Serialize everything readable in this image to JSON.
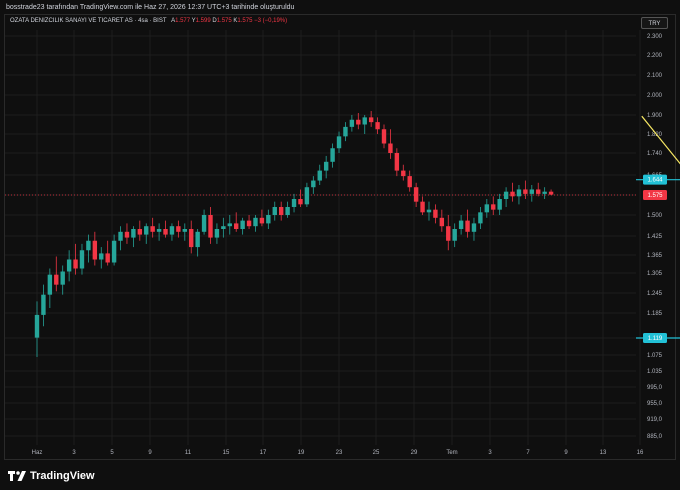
{
  "attribution": "bosstrade23 tarafından TradingView.com ile Haz 27, 2026 12:37 UTC+3 tarihinde oluşturuldu",
  "symbol_line": {
    "name": "OZATA DENIZCILIK SANAYI VE TICARET AS · 4sa · BIST",
    "o_label": "A",
    "o_value": "1.577",
    "h_label": "Y",
    "h_value": "1.599",
    "l_label": "D",
    "l_value": "1.575",
    "c_label": "K",
    "c_value": "1.575",
    "change": "−3 (−0,19%)"
  },
  "currency": "TRY",
  "brand": "TradingView",
  "colors": {
    "up": "#26a69a",
    "down": "#f23645",
    "pattern": "#f5e663",
    "level": "#22c1d6",
    "background": "#0f0f0f",
    "grid": "#1e1e1e"
  },
  "chart_data": {
    "type": "candlestick",
    "y_ticks": [
      "2.300",
      "2.200",
      "2.100",
      "2.000",
      "1.900",
      "1.820",
      "1.740",
      "1.665",
      "1.575",
      "1.500",
      "1.425",
      "1.365",
      "1.305",
      "1.245",
      "1.185",
      "1.119",
      "1.075",
      "1.035",
      "995,0",
      "955,0",
      "919,0",
      "885,0"
    ],
    "x_ticks": [
      "Haz",
      "3",
      "5",
      "9",
      "11",
      "15",
      "17",
      "19",
      "23",
      "25",
      "29",
      "Tem",
      "3",
      "7",
      "9",
      "13",
      "16"
    ],
    "last_price": {
      "value": 1.575,
      "label": "1.575"
    },
    "levels": [
      {
        "value": 1.644,
        "label": "1.644",
        "from_x": 23.0,
        "to_x": 40.0
      },
      {
        "value": 1.119,
        "label": "1.119",
        "from_x": 25.5,
        "to_x": 40.0
      }
    ],
    "projection": [
      {
        "x": 17.0,
        "y": 1.895
      },
      {
        "x": 20.0,
        "y": 1.36
      },
      {
        "x": 25.6,
        "y": 1.568
      },
      {
        "x": 29.0,
        "y": 1.119
      }
    ],
    "channel": {
      "upper": [
        {
          "x": 20.0,
          "y": 1.57
        },
        {
          "x": 26.5,
          "y": 1.785
        }
      ],
      "lower": [
        {
          "x": 20.0,
          "y": 1.36
        },
        {
          "x": 26.5,
          "y": 1.575
        }
      ],
      "mid": [
        {
          "x": 21.0,
          "y": 1.465
        },
        {
          "x": 26.5,
          "y": 1.66
        }
      ]
    },
    "candles": [
      {
        "x": 1.0,
        "o": 1.12,
        "h": 1.22,
        "l": 1.07,
        "c": 1.18
      },
      {
        "x": 1.17,
        "o": 1.18,
        "h": 1.27,
        "l": 1.15,
        "c": 1.24
      },
      {
        "x": 1.34,
        "o": 1.24,
        "h": 1.32,
        "l": 1.2,
        "c": 1.3
      },
      {
        "x": 1.51,
        "o": 1.3,
        "h": 1.36,
        "l": 1.25,
        "c": 1.27
      },
      {
        "x": 1.68,
        "o": 1.27,
        "h": 1.33,
        "l": 1.24,
        "c": 1.31
      },
      {
        "x": 1.85,
        "o": 1.31,
        "h": 1.38,
        "l": 1.28,
        "c": 1.35
      },
      {
        "x": 2.02,
        "o": 1.35,
        "h": 1.4,
        "l": 1.3,
        "c": 1.32
      },
      {
        "x": 2.19,
        "o": 1.32,
        "h": 1.4,
        "l": 1.3,
        "c": 1.38
      },
      {
        "x": 2.36,
        "o": 1.38,
        "h": 1.43,
        "l": 1.34,
        "c": 1.41
      },
      {
        "x": 2.53,
        "o": 1.41,
        "h": 1.44,
        "l": 1.33,
        "c": 1.35
      },
      {
        "x": 2.7,
        "o": 1.35,
        "h": 1.39,
        "l": 1.32,
        "c": 1.37
      },
      {
        "x": 2.87,
        "o": 1.37,
        "h": 1.41,
        "l": 1.33,
        "c": 1.34
      },
      {
        "x": 3.04,
        "o": 1.34,
        "h": 1.43,
        "l": 1.33,
        "c": 1.41
      },
      {
        "x": 3.21,
        "o": 1.41,
        "h": 1.46,
        "l": 1.38,
        "c": 1.44
      },
      {
        "x": 3.38,
        "o": 1.44,
        "h": 1.47,
        "l": 1.4,
        "c": 1.42
      },
      {
        "x": 3.55,
        "o": 1.42,
        "h": 1.46,
        "l": 1.39,
        "c": 1.45
      },
      {
        "x": 3.72,
        "o": 1.45,
        "h": 1.48,
        "l": 1.41,
        "c": 1.43
      },
      {
        "x": 3.89,
        "o": 1.43,
        "h": 1.47,
        "l": 1.4,
        "c": 1.46
      },
      {
        "x": 4.06,
        "o": 1.46,
        "h": 1.49,
        "l": 1.42,
        "c": 1.44
      },
      {
        "x": 4.23,
        "o": 1.44,
        "h": 1.47,
        "l": 1.41,
        "c": 1.45
      },
      {
        "x": 4.4,
        "o": 1.45,
        "h": 1.48,
        "l": 1.42,
        "c": 1.43
      },
      {
        "x": 4.57,
        "o": 1.43,
        "h": 1.47,
        "l": 1.41,
        "c": 1.46
      },
      {
        "x": 4.74,
        "o": 1.46,
        "h": 1.48,
        "l": 1.42,
        "c": 1.44
      },
      {
        "x": 4.91,
        "o": 1.44,
        "h": 1.47,
        "l": 1.41,
        "c": 1.45
      },
      {
        "x": 5.08,
        "o": 1.45,
        "h": 1.48,
        "l": 1.37,
        "c": 1.39
      },
      {
        "x": 5.25,
        "o": 1.39,
        "h": 1.45,
        "l": 1.36,
        "c": 1.44
      },
      {
        "x": 5.42,
        "o": 1.44,
        "h": 1.52,
        "l": 1.43,
        "c": 1.5
      },
      {
        "x": 5.59,
        "o": 1.5,
        "h": 1.53,
        "l": 1.4,
        "c": 1.42
      },
      {
        "x": 5.76,
        "o": 1.42,
        "h": 1.47,
        "l": 1.4,
        "c": 1.45
      },
      {
        "x": 5.93,
        "o": 1.45,
        "h": 1.49,
        "l": 1.42,
        "c": 1.46
      },
      {
        "x": 6.1,
        "o": 1.46,
        "h": 1.5,
        "l": 1.43,
        "c": 1.47
      },
      {
        "x": 6.27,
        "o": 1.47,
        "h": 1.51,
        "l": 1.44,
        "c": 1.45
      },
      {
        "x": 6.44,
        "o": 1.45,
        "h": 1.49,
        "l": 1.43,
        "c": 1.48
      },
      {
        "x": 6.61,
        "o": 1.48,
        "h": 1.5,
        "l": 1.45,
        "c": 1.46
      },
      {
        "x": 6.78,
        "o": 1.46,
        "h": 1.5,
        "l": 1.44,
        "c": 1.49
      },
      {
        "x": 6.95,
        "o": 1.49,
        "h": 1.52,
        "l": 1.46,
        "c": 1.47
      },
      {
        "x": 7.12,
        "o": 1.47,
        "h": 1.52,
        "l": 1.45,
        "c": 1.5
      },
      {
        "x": 7.29,
        "o": 1.5,
        "h": 1.55,
        "l": 1.48,
        "c": 1.53
      },
      {
        "x": 7.46,
        "o": 1.53,
        "h": 1.55,
        "l": 1.48,
        "c": 1.5
      },
      {
        "x": 7.63,
        "o": 1.5,
        "h": 1.55,
        "l": 1.49,
        "c": 1.53
      },
      {
        "x": 7.8,
        "o": 1.53,
        "h": 1.58,
        "l": 1.51,
        "c": 1.56
      },
      {
        "x": 7.97,
        "o": 1.56,
        "h": 1.6,
        "l": 1.53,
        "c": 1.54
      },
      {
        "x": 8.14,
        "o": 1.54,
        "h": 1.63,
        "l": 1.53,
        "c": 1.61
      },
      {
        "x": 8.31,
        "o": 1.61,
        "h": 1.66,
        "l": 1.58,
        "c": 1.64
      },
      {
        "x": 8.48,
        "o": 1.64,
        "h": 1.7,
        "l": 1.62,
        "c": 1.68
      },
      {
        "x": 8.65,
        "o": 1.68,
        "h": 1.73,
        "l": 1.65,
        "c": 1.71
      },
      {
        "x": 8.82,
        "o": 1.71,
        "h": 1.78,
        "l": 1.69,
        "c": 1.76
      },
      {
        "x": 8.99,
        "o": 1.76,
        "h": 1.83,
        "l": 1.74,
        "c": 1.81
      },
      {
        "x": 9.16,
        "o": 1.81,
        "h": 1.87,
        "l": 1.79,
        "c": 1.85
      },
      {
        "x": 9.33,
        "o": 1.85,
        "h": 1.9,
        "l": 1.83,
        "c": 1.88
      },
      {
        "x": 9.5,
        "o": 1.88,
        "h": 1.91,
        "l": 1.84,
        "c": 1.86
      },
      {
        "x": 9.67,
        "o": 1.86,
        "h": 1.9,
        "l": 1.82,
        "c": 1.89
      },
      {
        "x": 9.84,
        "o": 1.89,
        "h": 1.92,
        "l": 1.85,
        "c": 1.87
      },
      {
        "x": 10.01,
        "o": 1.87,
        "h": 1.89,
        "l": 1.82,
        "c": 1.84
      },
      {
        "x": 10.18,
        "o": 1.84,
        "h": 1.86,
        "l": 1.76,
        "c": 1.78
      },
      {
        "x": 10.35,
        "o": 1.78,
        "h": 1.84,
        "l": 1.72,
        "c": 1.74
      },
      {
        "x": 10.52,
        "o": 1.74,
        "h": 1.76,
        "l": 1.66,
        "c": 1.68
      },
      {
        "x": 10.69,
        "o": 1.68,
        "h": 1.7,
        "l": 1.64,
        "c": 1.66
      },
      {
        "x": 10.86,
        "o": 1.66,
        "h": 1.68,
        "l": 1.59,
        "c": 1.61
      },
      {
        "x": 11.03,
        "o": 1.61,
        "h": 1.63,
        "l": 1.53,
        "c": 1.55
      },
      {
        "x": 11.2,
        "o": 1.55,
        "h": 1.57,
        "l": 1.5,
        "c": 1.51
      },
      {
        "x": 11.37,
        "o": 1.51,
        "h": 1.55,
        "l": 1.48,
        "c": 1.52
      },
      {
        "x": 11.54,
        "o": 1.52,
        "h": 1.54,
        "l": 1.47,
        "c": 1.49
      },
      {
        "x": 11.71,
        "o": 1.49,
        "h": 1.52,
        "l": 1.44,
        "c": 1.46
      },
      {
        "x": 11.88,
        "o": 1.46,
        "h": 1.5,
        "l": 1.38,
        "c": 1.41
      },
      {
        "x": 12.05,
        "o": 1.41,
        "h": 1.47,
        "l": 1.39,
        "c": 1.45
      },
      {
        "x": 12.22,
        "o": 1.45,
        "h": 1.5,
        "l": 1.43,
        "c": 1.48
      },
      {
        "x": 12.39,
        "o": 1.48,
        "h": 1.52,
        "l": 1.42,
        "c": 1.44
      },
      {
        "x": 12.56,
        "o": 1.44,
        "h": 1.49,
        "l": 1.41,
        "c": 1.47
      },
      {
        "x": 12.73,
        "o": 1.47,
        "h": 1.53,
        "l": 1.45,
        "c": 1.51
      },
      {
        "x": 12.9,
        "o": 1.51,
        "h": 1.56,
        "l": 1.49,
        "c": 1.54
      },
      {
        "x": 13.07,
        "o": 1.54,
        "h": 1.57,
        "l": 1.5,
        "c": 1.52
      },
      {
        "x": 13.24,
        "o": 1.52,
        "h": 1.58,
        "l": 1.5,
        "c": 1.56
      },
      {
        "x": 13.41,
        "o": 1.56,
        "h": 1.61,
        "l": 1.53,
        "c": 1.59
      },
      {
        "x": 13.58,
        "o": 1.59,
        "h": 1.63,
        "l": 1.55,
        "c": 1.57
      },
      {
        "x": 13.75,
        "o": 1.57,
        "h": 1.62,
        "l": 1.54,
        "c": 1.6
      },
      {
        "x": 13.92,
        "o": 1.6,
        "h": 1.64,
        "l": 1.56,
        "c": 1.58
      },
      {
        "x": 14.09,
        "o": 1.58,
        "h": 1.62,
        "l": 1.55,
        "c": 1.6
      },
      {
        "x": 14.26,
        "o": 1.6,
        "h": 1.63,
        "l": 1.57,
        "c": 1.58
      },
      {
        "x": 14.43,
        "o": 1.58,
        "h": 1.61,
        "l": 1.56,
        "c": 1.59
      },
      {
        "x": 14.6,
        "o": 1.59,
        "h": 1.6,
        "l": 1.575,
        "c": 1.577
      }
    ]
  }
}
